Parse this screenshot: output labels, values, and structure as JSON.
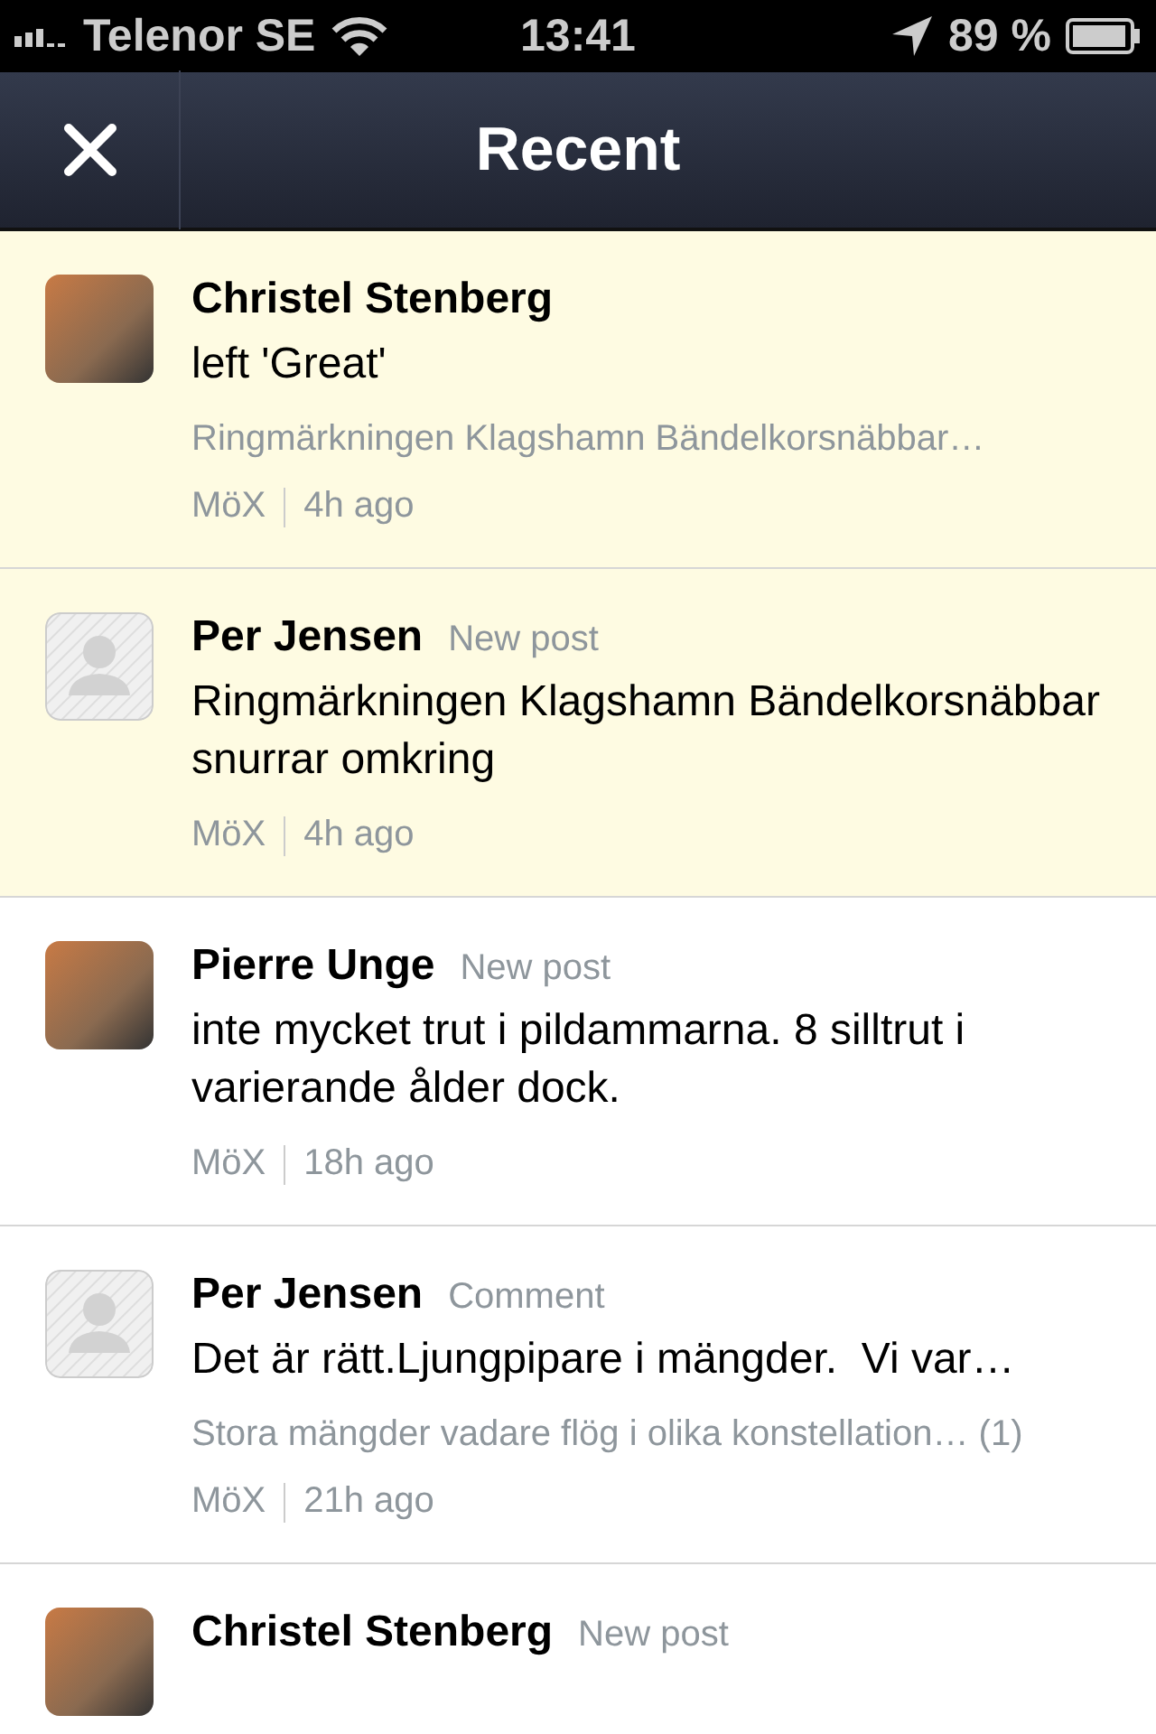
{
  "status_bar": {
    "carrier": "Telenor SE",
    "time": "13:41",
    "battery": "89 %"
  },
  "nav": {
    "title": "Recent"
  },
  "items": [
    {
      "kind": "photo",
      "unread": true,
      "name": "Christel Stenberg",
      "text": "left 'Great'",
      "context": "Ringmärkningen Klagshamn Bändelkorsnäbbar…",
      "group": "MöX",
      "time": "4h ago"
    },
    {
      "kind": "placeholder",
      "unread": true,
      "name": "Per Jensen",
      "type": "New post",
      "text": "Ringmärkningen Klagshamn Bändelkorsnäbbar snurrar omkring",
      "group": "MöX",
      "time": "4h ago"
    },
    {
      "kind": "photo",
      "unread": false,
      "name": "Pierre Unge",
      "type": "New post",
      "text": "inte mycket trut i pildammarna. 8 silltrut i varierande ålder dock.",
      "group": "MöX",
      "time": "18h ago"
    },
    {
      "kind": "placeholder",
      "unread": false,
      "name": "Per Jensen",
      "type": "Comment",
      "text": "Det är rätt.Ljungpipare i mängder.  Vi var…",
      "context": "Stora mängder vadare flög i olika konstellation… (1)",
      "group": "MöX",
      "time": "21h ago"
    },
    {
      "kind": "photo",
      "unread": false,
      "name": "Christel Stenberg",
      "type": "New post"
    }
  ]
}
